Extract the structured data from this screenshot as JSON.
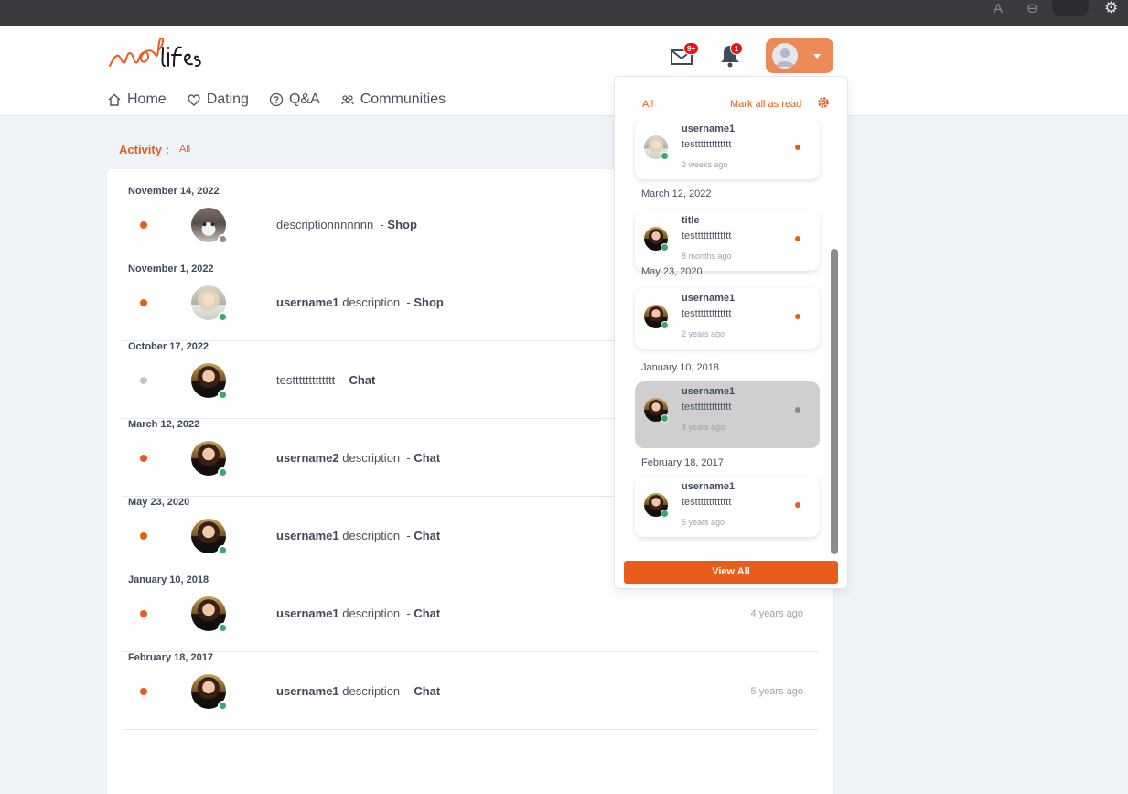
{
  "nav": {
    "home": "Home",
    "dating": "Dating",
    "qa": "Q&A",
    "communities": "Communities"
  },
  "header": {
    "mail_badge": "9+",
    "bell_badge": "1"
  },
  "activity": {
    "label": "Activity :",
    "filter": "All",
    "groups": [
      {
        "date": "November 14, 2022",
        "user": "",
        "text": "descriptionnnnnnn",
        "type": "Shop",
        "ago": "",
        "dot": "#e85d1a",
        "status": "#8c8c8c",
        "avatar": "cat"
      },
      {
        "date": "November 1, 2022",
        "user": "username1",
        "text": "description",
        "type": "Shop",
        "ago": "",
        "dot": "#e85d1a",
        "status": "#3aa76d",
        "avatar": "light"
      },
      {
        "date": "October 17, 2022",
        "user": "",
        "text": "testtttttttttttt",
        "type": "Chat",
        "ago": "",
        "dot": "#c4c4c4",
        "status": "#3aa76d",
        "avatar": "dark"
      },
      {
        "date": "March 12, 2022",
        "user": "username2",
        "text": "description",
        "type": "Chat",
        "ago": "",
        "dot": "#e85d1a",
        "status": "#3aa76d",
        "avatar": "dark"
      },
      {
        "date": "May 23, 2020",
        "user": "username1",
        "text": "description",
        "type": "Chat",
        "ago": "",
        "dot": "#e85d1a",
        "status": "#3aa76d",
        "avatar": "dark"
      },
      {
        "date": "January 10, 2018",
        "user": "username1",
        "text": "description",
        "type": "Chat",
        "ago": "4 years ago",
        "dot": "#e85d1a",
        "status": "#3aa76d",
        "avatar": "dark"
      },
      {
        "date": "February 18, 2017",
        "user": "username1",
        "text": "description",
        "type": "Chat",
        "ago": "5 years ago",
        "dot": "#e85d1a",
        "status": "#3aa76d",
        "avatar": "dark"
      }
    ]
  },
  "notifications": {
    "tab_all": "All",
    "mark_all": "Mark all as read",
    "view_all": "View All",
    "items": [
      {
        "date_before": "",
        "title": "username1",
        "text": "testtttttttttttt",
        "ago": "2 weeks ago",
        "avatar": "light",
        "active": false
      },
      {
        "date_before": "March 12, 2022",
        "title": "title",
        "text": "testtttttttttttt",
        "ago": "8 months ago",
        "avatar": "dark",
        "active": false
      },
      {
        "date_before": "May 23, 2020",
        "title": "username1",
        "text": "testtttttttttttt",
        "ago": "2 years ago",
        "avatar": "dark",
        "active": false
      },
      {
        "date_before": "January 10, 2018",
        "title": "username1",
        "text": "testtttttttttttt",
        "ago": "4 years ago",
        "avatar": "dark",
        "active": true
      },
      {
        "date_before": "February 18, 2017",
        "title": "username1",
        "text": "testtttttttttttt",
        "ago": "5 years ago",
        "avatar": "dark",
        "active": false
      }
    ]
  },
  "colors": {
    "accent": "#e85d1a",
    "online": "#3aa76d",
    "offline": "#8c8c8c"
  }
}
